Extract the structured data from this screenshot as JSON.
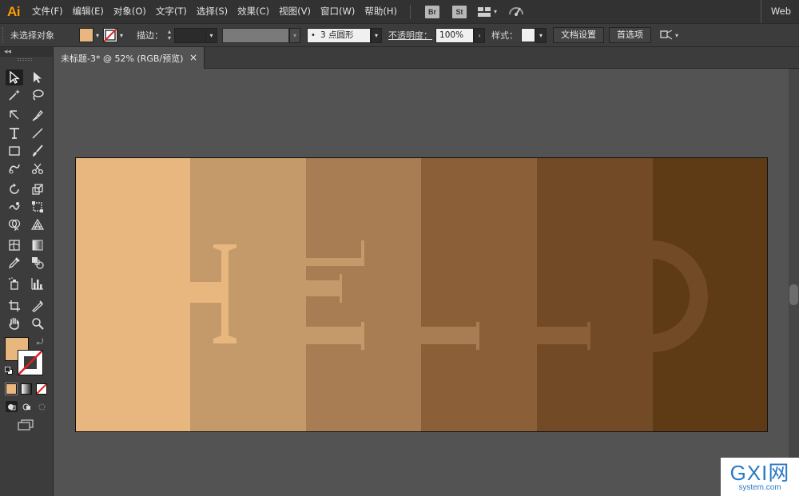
{
  "app": {
    "logo": "Ai",
    "workspace": "Web"
  },
  "menu": [
    "文件(F)",
    "编辑(E)",
    "对象(O)",
    "文字(T)",
    "选择(S)",
    "效果(C)",
    "视图(V)",
    "窗口(W)",
    "帮助(H)"
  ],
  "app_buttons": {
    "bridge": "Br",
    "stock": "St"
  },
  "control_bar": {
    "selection_status": "未选择对象",
    "fill_color": "#e8b77f",
    "stroke_label": "描边：",
    "brush_label": "3 点圆形",
    "opacity_label": "不透明度：",
    "opacity_value": "100%",
    "style_label": "样式：",
    "doc_setup_button": "文档设置",
    "preferences_button": "首选项"
  },
  "document_tab": {
    "title": "未标题-3* @ 52% (RGB/预览)",
    "close": "×"
  },
  "artboard": {
    "stripes": [
      {
        "color": "#e8b77f",
        "width": 143
      },
      {
        "color": "#c59a6b",
        "width": 145
      },
      {
        "color": "#a87d54",
        "width": 144
      },
      {
        "color": "#8b6039",
        "width": 145
      },
      {
        "color": "#724a26",
        "width": 145
      },
      {
        "color": "#5e3a15",
        "width": 145
      }
    ]
  },
  "watermark": {
    "title": "GXI网",
    "subtitle": "system.com"
  },
  "icons": [
    "selection-icon",
    "direct-selection-icon",
    "magic-wand-icon",
    "lasso-icon",
    "pen-icon",
    "curvature-icon",
    "type-icon",
    "line-icon",
    "rectangle-icon",
    "paintbrush-icon",
    "shaper-icon",
    "scissors-icon",
    "rotate-icon",
    "scale-icon",
    "warp-icon",
    "free-transform-icon",
    "shape-builder-icon",
    "perspective-icon",
    "mesh-icon",
    "gradient-icon",
    "eyedropper-icon",
    "blend-icon",
    "symbol-sprayer-icon",
    "column-graph-icon",
    "artboard-icon",
    "slice-icon",
    "hand-icon",
    "zoom-icon"
  ]
}
